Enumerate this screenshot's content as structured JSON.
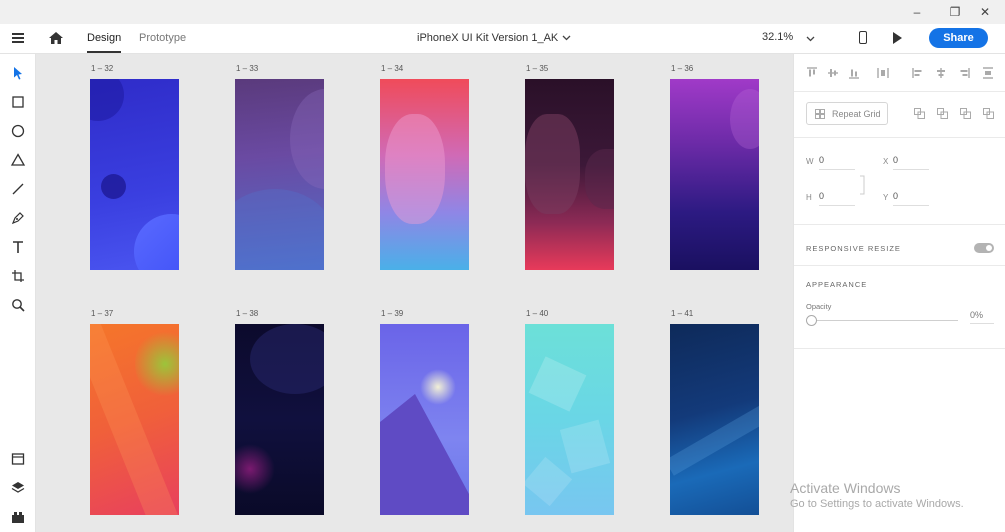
{
  "window": {
    "minimize": "–",
    "maximize": "❐",
    "close": "✕"
  },
  "header": {
    "tabs": [
      {
        "label": "Design"
      },
      {
        "label": "Prototype"
      }
    ],
    "doc_title": "iPhoneX UI Kit Version 1_AK",
    "zoom": "32.1%",
    "share_label": "Share"
  },
  "artboards": [
    {
      "label": "1 – 32"
    },
    {
      "label": "1 – 33"
    },
    {
      "label": "1 – 34"
    },
    {
      "label": "1 – 35"
    },
    {
      "label": "1 – 36"
    },
    {
      "label": "1 – 37"
    },
    {
      "label": "1 – 38"
    },
    {
      "label": "1 – 39"
    },
    {
      "label": "1 – 40"
    },
    {
      "label": "1 – 41"
    }
  ],
  "panel": {
    "repeat_grid_label": "Repeat Grid",
    "fields": {
      "w_label": "W",
      "w_value": "0",
      "h_label": "H",
      "h_value": "0",
      "x_label": "X",
      "x_value": "0",
      "y_label": "Y",
      "y_value": "0"
    },
    "responsive_resize_label": "RESPONSIVE RESIZE",
    "appearance_label": "APPEARANCE",
    "opacity_label": "Opacity",
    "opacity_value": "0%"
  },
  "watermark": {
    "line1": "Activate Windows",
    "line2": "Go to Settings to activate Windows."
  },
  "colors": {
    "accent": "#1473e6"
  }
}
